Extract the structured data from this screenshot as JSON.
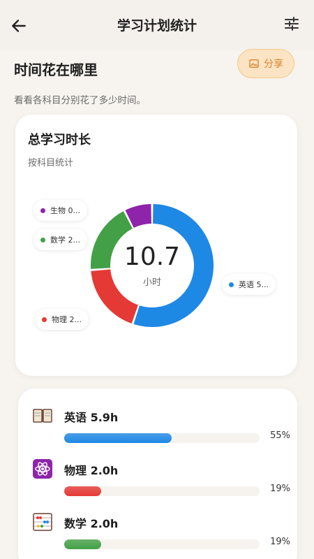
{
  "header": {
    "title": "学习计划统计",
    "back_icon": "back-arrow-icon",
    "filter_icon": "sliders-icon"
  },
  "section": {
    "title": "时间花在哪里",
    "subtitle": "看看各科目分别花了多少时间。",
    "share_label": "分享",
    "share_icon": "image-icon"
  },
  "summary": {
    "title": "总学习时长",
    "subtitle": "按科目统计",
    "total": "10.7",
    "unit": "小时",
    "legend": [
      {
        "label": "生物 0...",
        "color": "#8e24aa"
      },
      {
        "label": "数学 2...",
        "color": "#43a047"
      },
      {
        "label": "物理 2...",
        "color": "#e53935"
      },
      {
        "label": "英语 5...",
        "color": "#1e88e5"
      }
    ]
  },
  "chart_data": {
    "type": "pie",
    "categories": [
      "英语",
      "物理",
      "数学",
      "生物"
    ],
    "values": [
      5.9,
      2.0,
      2.0,
      0.8
    ],
    "colors": [
      "#1e88e5",
      "#e53935",
      "#43a047",
      "#8e24aa"
    ],
    "title": "总学习时长"
  },
  "subjects": [
    {
      "label": "英语 5.9h",
      "percent_label": "55%",
      "fraction": 0.55,
      "color": "#1e88e5",
      "icon": "book-icon"
    },
    {
      "label": "物理 2.0h",
      "percent_label": "19%",
      "fraction": 0.19,
      "color": "#e53935",
      "icon": "atom-icon"
    },
    {
      "label": "数学 2.0h",
      "percent_label": "19%",
      "fraction": 0.19,
      "color": "#43a047",
      "icon": "abacus-icon"
    }
  ]
}
